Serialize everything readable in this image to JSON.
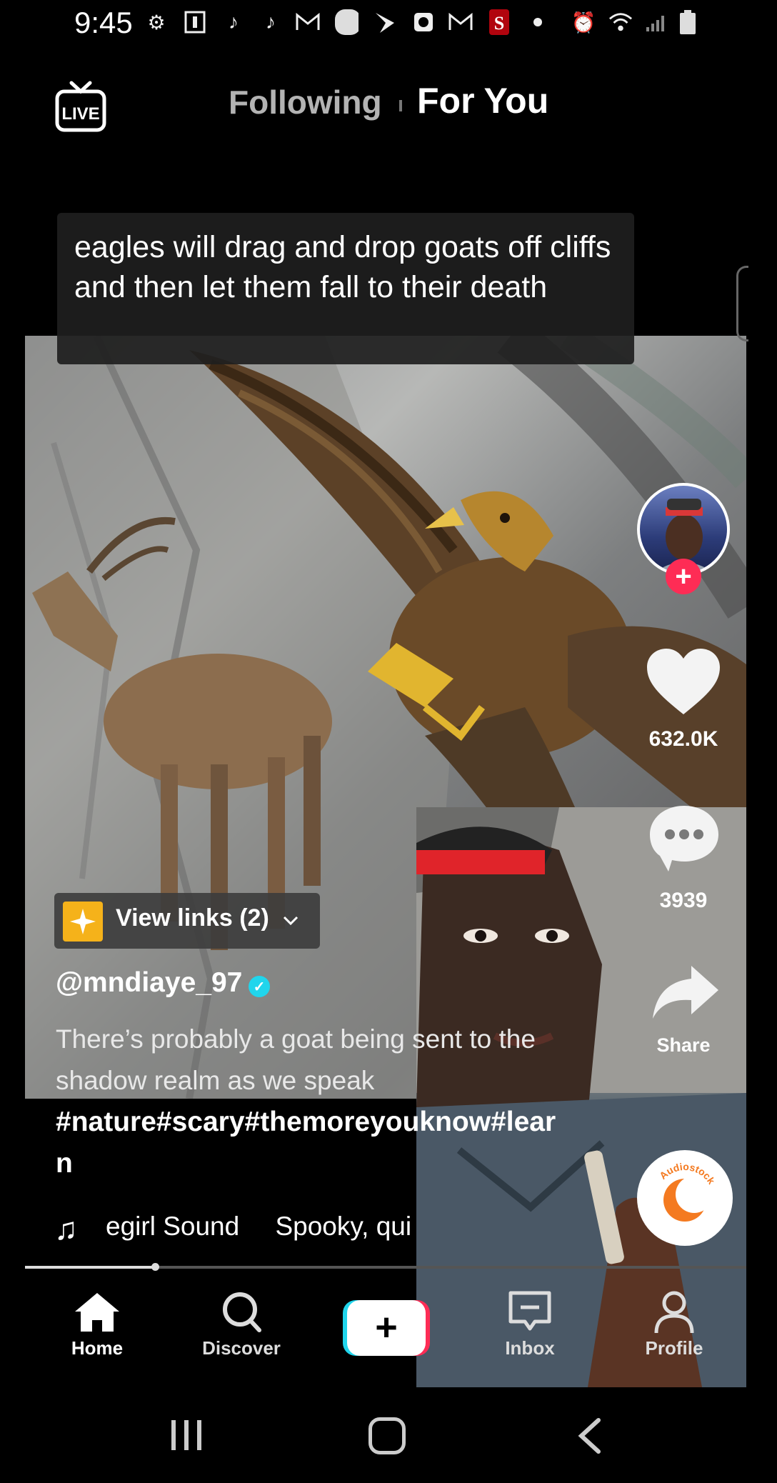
{
  "status_bar": {
    "time": "9:45",
    "left_icons": [
      "gear-icon",
      "info-icon",
      "tiktok-icon",
      "tiktok-icon",
      "gmail-icon",
      "circle-icon",
      "sprint-icon",
      "clock-app-icon",
      "gmail-icon",
      "stanford-icon",
      "dot-icon"
    ],
    "right_icons": [
      "alarm-icon",
      "wifi-icon",
      "signal-icon",
      "battery-icon"
    ]
  },
  "top_nav": {
    "live_label": "LIVE",
    "tabs": [
      {
        "label": "Following",
        "active": false
      },
      {
        "label": "For You",
        "active": true
      }
    ]
  },
  "video": {
    "caption_overlay": "eagles will drag and drop goats off cliffs and then let them fall to their death",
    "sound_disc_brand": "Audiostock"
  },
  "actions": {
    "like_count": "632.0K",
    "comment_count": "3939",
    "share_label": "Share",
    "follow_symbol": "+"
  },
  "post": {
    "view_links_label": "View links (2)",
    "username": "@mndiaye_97",
    "verified": true,
    "description": "There’s probably a goat being sent to the shadow realm as we speak",
    "hashtags": "#nature#scary#themoreyouknow#learn",
    "sound_segments": [
      "egirl Sound",
      "Spooky, qui"
    ],
    "progress": 0.18
  },
  "bottom_nav": {
    "items": [
      {
        "label": "Home",
        "icon": "home-icon",
        "active": true
      },
      {
        "label": "Discover",
        "icon": "search-icon",
        "active": false
      },
      {
        "label": "Inbox",
        "icon": "inbox-icon",
        "active": false
      },
      {
        "label": "Profile",
        "icon": "profile-icon",
        "active": false
      }
    ],
    "create_symbol": "+"
  },
  "colors": {
    "accent_red": "#fe2c55",
    "accent_cyan": "#20d5ec",
    "background": "#000000"
  }
}
